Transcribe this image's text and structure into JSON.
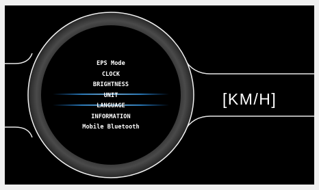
{
  "menu": {
    "items": [
      {
        "label": "EPS Mode"
      },
      {
        "label": "CLOCK"
      },
      {
        "label": "BRIGHTNESS"
      },
      {
        "label": "UNIT"
      },
      {
        "label": "LANGUAGE"
      },
      {
        "label": "INFORMATION"
      },
      {
        "label": "Mobile Bluetooth"
      }
    ],
    "selected_index": 3
  },
  "unit_display": {
    "value": "[KM/H]"
  },
  "colors": {
    "background": "#000000",
    "ring": "#3a3a3a",
    "highlight": "#1e90ff",
    "text": "#ffffff"
  }
}
